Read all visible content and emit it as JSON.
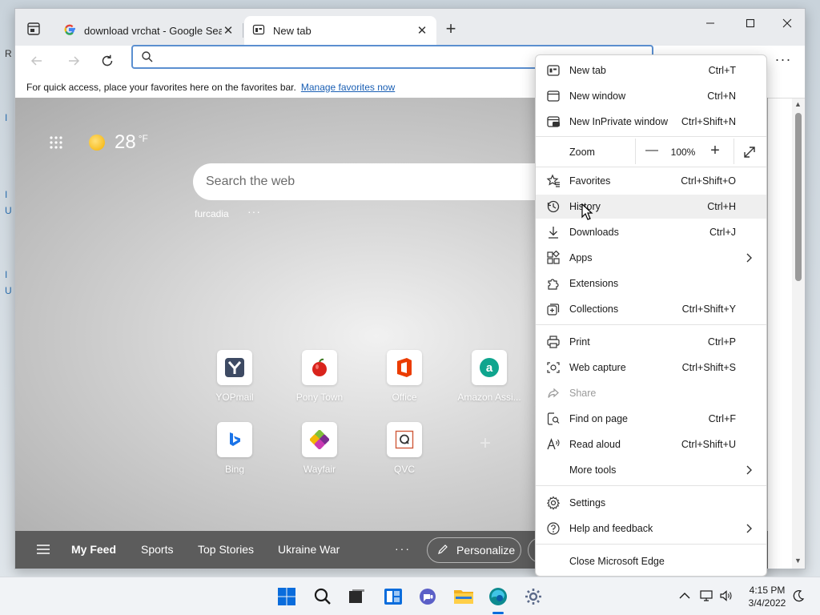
{
  "desktop": {
    "fragments": [
      "R",
      "I",
      "I",
      "U",
      "I",
      "U"
    ]
  },
  "tabs": [
    {
      "title": "download vrchat - Google Search",
      "active": false
    },
    {
      "title": "New tab",
      "active": true
    }
  ],
  "address": {
    "value": "",
    "placeholder": ""
  },
  "favorites_bar": {
    "message": "For quick access, place your favorites here on the favorites bar.",
    "link": "Manage favorites now"
  },
  "ntp": {
    "weather_temp": "28",
    "weather_unit": "°F",
    "search_placeholder": "Search the web",
    "quick_link": "furcadia",
    "quick_more": "···",
    "tiles": [
      {
        "label": "YOPmail",
        "icon": "yopmail-icon"
      },
      {
        "label": "Pony Town",
        "icon": "apple-icon"
      },
      {
        "label": "Office",
        "icon": "office-icon"
      },
      {
        "label": "Amazon Assi...",
        "icon": "amazon-assistant-icon"
      },
      {
        "label": "Bing",
        "icon": "bing-icon"
      },
      {
        "label": "Wayfair",
        "icon": "wayfair-icon"
      },
      {
        "label": "QVC",
        "icon": "qvc-icon"
      }
    ],
    "add_tile": "+",
    "feed": {
      "items": [
        "My Feed",
        "Sports",
        "Top Stories",
        "Ukraine War"
      ],
      "more": "···",
      "personalize": "Personalize"
    }
  },
  "menu": {
    "items": [
      {
        "label": "New tab",
        "shortcut": "Ctrl+T"
      },
      {
        "label": "New window",
        "shortcut": "Ctrl+N"
      },
      {
        "label": "New InPrivate window",
        "shortcut": "Ctrl+Shift+N"
      },
      {
        "label": "Favorites",
        "shortcut": "Ctrl+Shift+O"
      },
      {
        "label": "History",
        "shortcut": "Ctrl+H"
      },
      {
        "label": "Downloads",
        "shortcut": "Ctrl+J"
      },
      {
        "label": "Apps",
        "shortcut": ""
      },
      {
        "label": "Extensions",
        "shortcut": ""
      },
      {
        "label": "Collections",
        "shortcut": "Ctrl+Shift+Y"
      },
      {
        "label": "Print",
        "shortcut": "Ctrl+P"
      },
      {
        "label": "Web capture",
        "shortcut": "Ctrl+Shift+S"
      },
      {
        "label": "Share",
        "shortcut": ""
      },
      {
        "label": "Find on page",
        "shortcut": "Ctrl+F"
      },
      {
        "label": "Read aloud",
        "shortcut": "Ctrl+Shift+U"
      },
      {
        "label": "More tools",
        "shortcut": ""
      },
      {
        "label": "Settings",
        "shortcut": ""
      },
      {
        "label": "Help and feedback",
        "shortcut": ""
      },
      {
        "label": "Close Microsoft Edge",
        "shortcut": ""
      }
    ],
    "zoom": {
      "label": "Zoom",
      "value": "100%",
      "minus": "—",
      "plus": "+"
    }
  },
  "clock": {
    "time": "4:15 PM",
    "date": "3/4/2022"
  },
  "colors": {
    "accent": "#0a6cdc",
    "feedbar": "#5c5c5c"
  }
}
